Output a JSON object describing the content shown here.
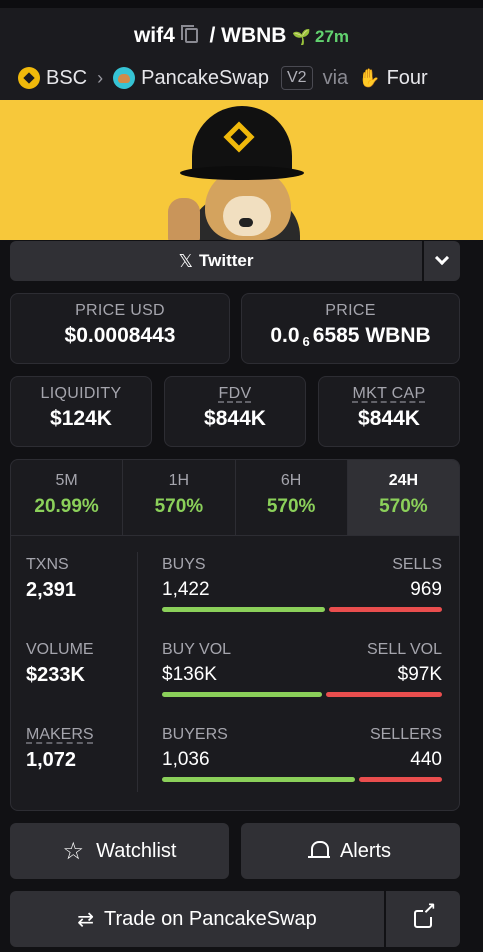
{
  "header": {
    "base_token": "wif4",
    "separator": "/",
    "quote_token": "WBNB",
    "age": "27m",
    "chain": "BSC",
    "dex": "PancakeSwap",
    "version": "V2",
    "via": "via",
    "launchpad": "Four"
  },
  "social": {
    "twitter_label": "Twitter"
  },
  "price": {
    "usd_label": "PRICE USD",
    "usd_value": "$0.0008443",
    "native_label": "PRICE",
    "native_prefix": "0.0",
    "native_zeros": "6",
    "native_digits": "6585",
    "native_unit": "WBNB"
  },
  "metrics": [
    {
      "label": "LIQUIDITY",
      "value": "$124K"
    },
    {
      "label": "FDV",
      "value": "$844K"
    },
    {
      "label": "MKT CAP",
      "value": "$844K"
    }
  ],
  "timeframes": [
    {
      "label": "5M",
      "change": "20.99%"
    },
    {
      "label": "1H",
      "change": "570%"
    },
    {
      "label": "6H",
      "change": "570%"
    },
    {
      "label": "24H",
      "change": "570%"
    }
  ],
  "stats": {
    "txns_label": "TXNS",
    "txns": "2,391",
    "volume_label": "VOLUME",
    "volume": "$233K",
    "makers_label": "MAKERS",
    "makers": "1,072"
  },
  "pairs": {
    "buys_label": "BUYS",
    "buys": "1,422",
    "sells_label": "SELLS",
    "sells": "969",
    "buys_ratio": 0.59,
    "buyvol_label": "BUY VOL",
    "buyvol": "$136K",
    "sellvol_label": "SELL VOL",
    "sellvol": "$97K",
    "buyvol_ratio": 0.58,
    "buyers_label": "BUYERS",
    "buyers": "1,036",
    "sellers_label": "SELLERS",
    "sellers": "440",
    "buyers_ratio": 0.7
  },
  "actions": {
    "watchlist": "Watchlist",
    "alerts": "Alerts",
    "trade": "Trade on PancakeSwap"
  },
  "colors": {
    "accent_green": "#8bd05a",
    "sell_red": "#ea4e4e",
    "banner_yellow": "#f7c83a"
  }
}
